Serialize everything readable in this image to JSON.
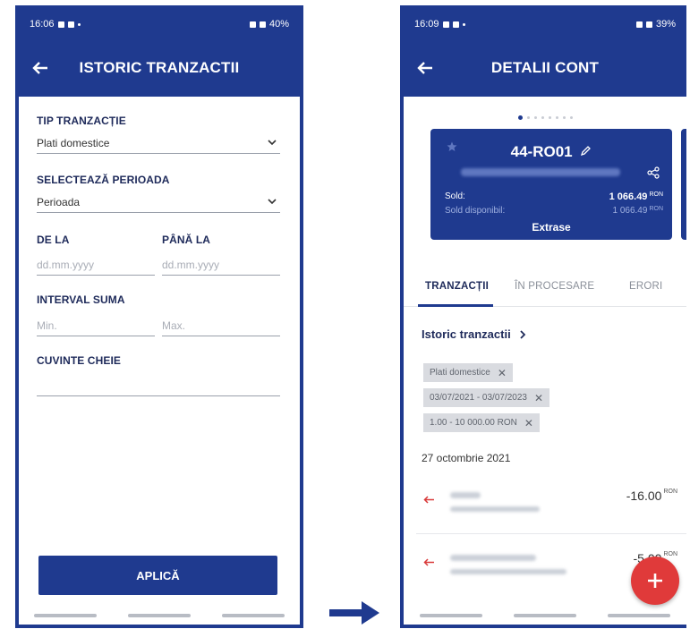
{
  "screen_left": {
    "status": {
      "time": "16:06",
      "battery": "40%"
    },
    "title": "ISTORIC TRANZACTII",
    "fields": {
      "type_label": "TIP TRANZACȚIE",
      "type_value": "Plati domestice",
      "period_label": "SELECTEAZĂ PERIOADA",
      "period_value": "Perioada",
      "from_label": "DE LA",
      "from_placeholder": "dd.mm.yyyy",
      "to_label": "PÂNĂ LA",
      "to_placeholder": "dd.mm.yyyy",
      "amount_label": "INTERVAL SUMA",
      "min_placeholder": "Min.",
      "max_placeholder": "Max.",
      "keywords_label": "CUVINTE CHEIE"
    },
    "apply_label": "APLICĂ"
  },
  "screen_right": {
    "status": {
      "time": "16:09",
      "battery": "39%"
    },
    "title": "DETALII CONT",
    "card": {
      "name": "44-RO01",
      "balance_label": "Sold:",
      "balance_value": "1 066.49",
      "available_label": "Sold disponibil:",
      "available_value": "1 066.49",
      "currency": "RON",
      "statements_label": "Extrase"
    },
    "tabs": [
      "TRANZACȚII",
      "ÎN PROCESARE",
      "ERORI"
    ],
    "history_link": "Istoric tranzactii",
    "filters": [
      "Plati domestice",
      "03/07/2021 - 03/07/2023",
      "1.00 - 10 000.00 RON"
    ],
    "date_header": "27 octombrie 2021",
    "transactions": [
      {
        "amount": "-16.00",
        "currency": "RON"
      },
      {
        "amount": "-5.00",
        "currency": "RON"
      }
    ]
  },
  "colors": {
    "primary": "#1f3a8f",
    "accent": "#e03a3a",
    "chip": "#d9dbe0"
  }
}
